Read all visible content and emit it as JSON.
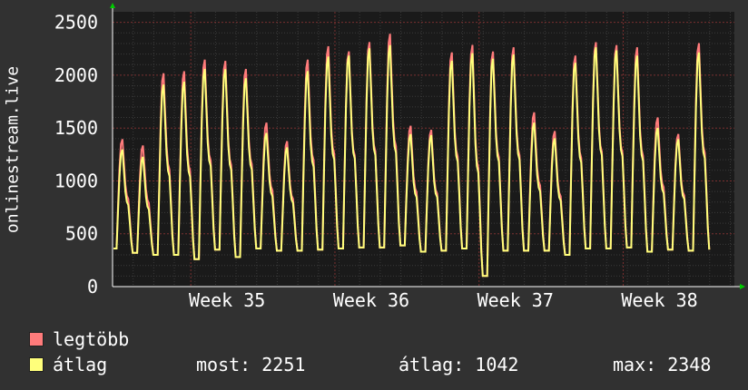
{
  "chart_data": {
    "type": "line",
    "ylabel": "onlinestream.live",
    "ylim": [
      0,
      2600
    ],
    "yticks": [
      0,
      500,
      1000,
      1500,
      2000,
      2500
    ],
    "x_ticks": [
      "Week 35",
      "Week 36",
      "Week 37",
      "Week 38"
    ],
    "grid": true,
    "days": [
      {
        "max": 1400,
        "avg": 1320,
        "min": 320
      },
      {
        "max": 1340,
        "avg": 1250,
        "min": 300
      },
      {
        "max": 2040,
        "avg": 1950,
        "min": 300
      },
      {
        "max": 2060,
        "avg": 1980,
        "min": 260
      },
      {
        "max": 2170,
        "avg": 2100,
        "min": 350
      },
      {
        "max": 2160,
        "avg": 2100,
        "min": 280
      },
      {
        "max": 2080,
        "avg": 2010,
        "min": 360
      },
      {
        "max": 1560,
        "avg": 1480,
        "min": 340
      },
      {
        "max": 1380,
        "avg": 1340,
        "min": 340
      },
      {
        "max": 2170,
        "avg": 2080,
        "min": 350
      },
      {
        "max": 2300,
        "avg": 2220,
        "min": 360
      },
      {
        "max": 2250,
        "avg": 2230,
        "min": 370
      },
      {
        "max": 2340,
        "avg": 2300,
        "min": 370
      },
      {
        "max": 2420,
        "avg": 2330,
        "min": 390
      },
      {
        "max": 1530,
        "avg": 1470,
        "min": 330
      },
      {
        "max": 1490,
        "avg": 1460,
        "min": 340
      },
      {
        "max": 2240,
        "avg": 2180,
        "min": 360
      },
      {
        "max": 2320,
        "avg": 2260,
        "min": 100
      },
      {
        "max": 2250,
        "avg": 2200,
        "min": 340
      },
      {
        "max": 2290,
        "avg": 2240,
        "min": 340
      },
      {
        "max": 1660,
        "avg": 1580,
        "min": 340
      },
      {
        "max": 1480,
        "avg": 1430,
        "min": 300
      },
      {
        "max": 2210,
        "avg": 2160,
        "min": 360
      },
      {
        "max": 2340,
        "avg": 2310,
        "min": 360
      },
      {
        "max": 2310,
        "avg": 2280,
        "min": 370
      },
      {
        "max": 2290,
        "avg": 2230,
        "min": 330
      },
      {
        "max": 1610,
        "avg": 1530,
        "min": 350
      },
      {
        "max": 1450,
        "avg": 1420,
        "min": 340
      },
      {
        "max": 2330,
        "avg": 2260,
        "min": 350
      }
    ],
    "series": [
      {
        "name": "legtöbb",
        "color": "#ff7b7b"
      },
      {
        "name": "átlag",
        "color": "#ffff7b"
      }
    ]
  },
  "legend": {
    "items": [
      {
        "label": "legtöbb",
        "color": "#ff7b7b"
      },
      {
        "label": "átlag",
        "color": "#ffff7b"
      }
    ],
    "stats": {
      "now_label": "most: 2251",
      "avg_label": "átlag: 1042",
      "max_label": "max: 2348"
    }
  }
}
